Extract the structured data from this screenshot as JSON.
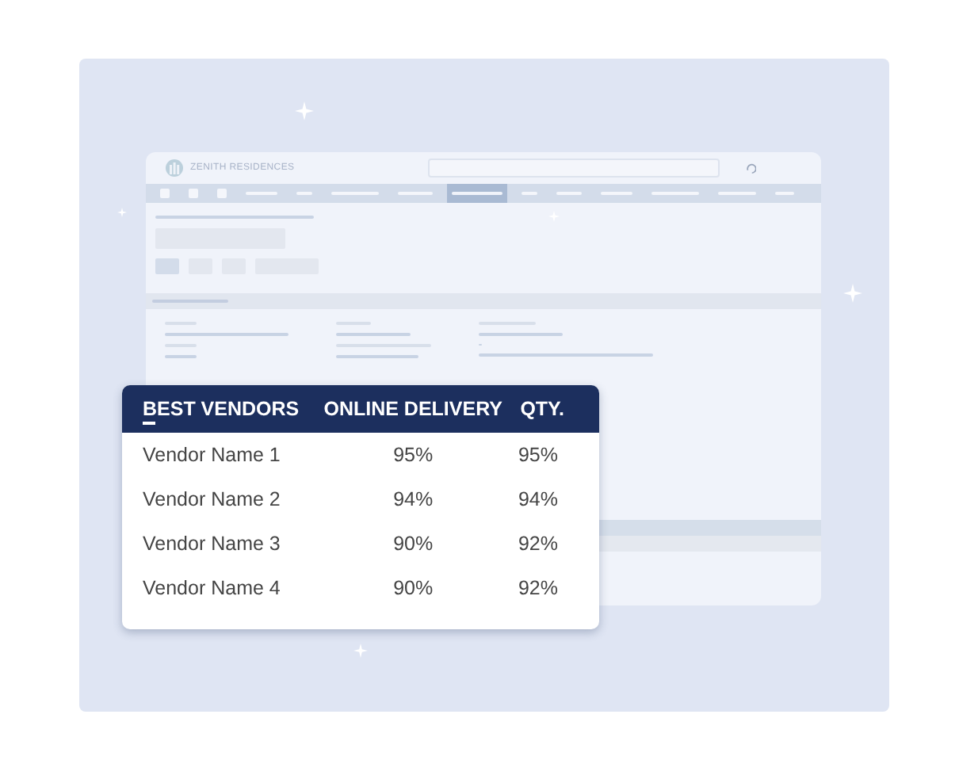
{
  "app": {
    "brand": "ZENITH RESIDENCES",
    "nav_items": [
      {
        "selected": false
      },
      {
        "selected": false
      },
      {
        "selected": false
      },
      {
        "selected": false
      },
      {
        "selected": false
      },
      {
        "selected": false
      },
      {
        "selected": false
      },
      {
        "selected": true
      },
      {
        "selected": false
      },
      {
        "selected": false
      },
      {
        "selected": false
      },
      {
        "selected": false
      },
      {
        "selected": false
      },
      {
        "selected": false
      }
    ]
  },
  "table": {
    "columns": [
      {
        "label": "BEST VENDORS",
        "sorted": true
      },
      {
        "label": "ONLINE DELIVERY",
        "sorted": false
      },
      {
        "label": "QTY.",
        "sorted": false
      }
    ],
    "rows": [
      [
        "Vendor Name 1",
        "95%",
        "95%"
      ],
      [
        "Vendor Name 2",
        "94%",
        "94%"
      ],
      [
        "Vendor Name 3",
        "90%",
        "92%"
      ],
      [
        "Vendor Name 4",
        "90%",
        "92%"
      ]
    ]
  }
}
